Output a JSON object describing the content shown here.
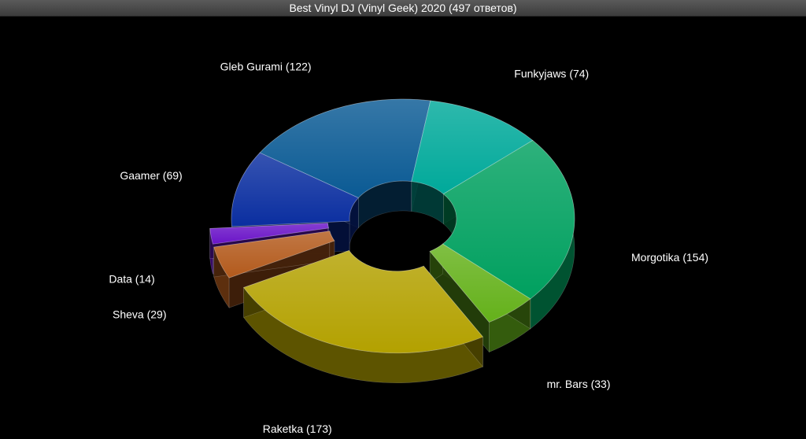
{
  "window": {
    "title": "Best Vinyl DJ (Vinyl Geek) 2020 (497 ответов)"
  },
  "chart_data": {
    "type": "pie",
    "variant": "3d-donut",
    "title": "Best Vinyl DJ (Vinyl Geek) 2020 (497 ответов)",
    "total": 497,
    "slices": [
      {
        "name": "Funkyjaws",
        "value": 74,
        "label": "Funkyjaws (74)",
        "color": "#00a99a",
        "exploded": false
      },
      {
        "name": "Morgotika",
        "value": 154,
        "label": "Morgotika (154)",
        "color": "#00a05f",
        "exploded": false
      },
      {
        "name": "mr. Bars",
        "value": 33,
        "label": "mr. Bars (33)",
        "color": "#64b11a",
        "exploded": false
      },
      {
        "name": "Raketka",
        "value": 173,
        "label": "Raketka (173)",
        "color": "#b3a100",
        "exploded": true
      },
      {
        "name": "Sheva",
        "value": 29,
        "label": "Sheva (29)",
        "color": "#b35a1c",
        "exploded": true
      },
      {
        "name": "Data",
        "value": 14,
        "label": "Data (14)",
        "color": "#6a14c8",
        "exploded": true
      },
      {
        "name": "Gaamer",
        "value": 69,
        "label": "Gaamer (69)",
        "color": "#0a2ea0",
        "exploded": false
      },
      {
        "name": "Gleb Gurami",
        "value": 122,
        "label": "Gleb Gurami (122)",
        "color": "#0a5a94",
        "exploded": false
      }
    ]
  }
}
